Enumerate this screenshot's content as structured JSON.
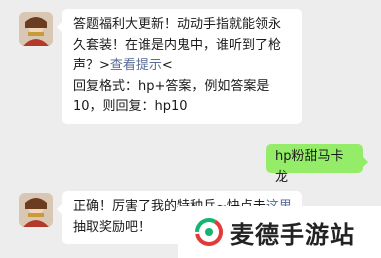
{
  "messages": [
    {
      "from": "bot",
      "text_parts": [
        "答题福利大更新！动动手指就能领永久套装！在谁是内鬼中，谁听到了枪声？>",
        "查看提示",
        "<",
        "回复格式：hp+答案，例如答案是10，则回复：hp10"
      ]
    },
    {
      "from": "user",
      "text": "hp粉甜马卡龙"
    },
    {
      "from": "bot",
      "text_parts": [
        "正确！厉害了我的特种兵~快点击",
        "这里",
        "抽取奖励吧！"
      ]
    }
  ],
  "watermark": {
    "text": "麦德手游站"
  },
  "colors": {
    "background": "#ededed",
    "bubble_left": "#ffffff",
    "bubble_right": "#95ec69",
    "link": "#576b95",
    "logo_red": "#e23b3b",
    "logo_green": "#13b56f"
  }
}
